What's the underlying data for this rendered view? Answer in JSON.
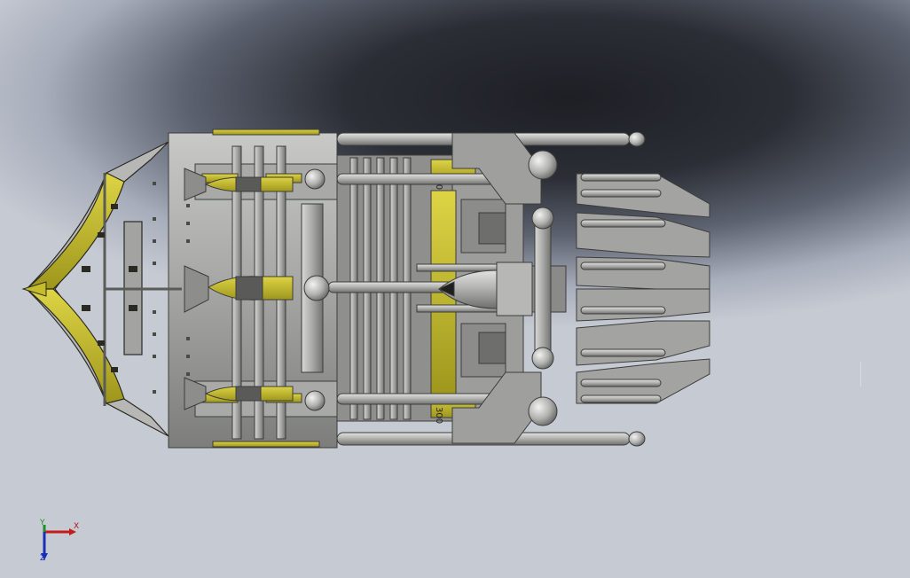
{
  "viewport": {
    "background_top": "#1d1f25",
    "background_bottom": "#c6cad3"
  },
  "model": {
    "body_color": "#9c9d9b",
    "accent_color": "#c5bc2c",
    "stripe_color": "#2a2a22",
    "decals": [
      {
        "text": "300"
      },
      {
        "text": "300"
      }
    ]
  },
  "triad": {
    "x_label": "X",
    "y_label": "Y",
    "z_label": "Z",
    "x_color": "#c41c1c",
    "y_color": "#1f8f2a",
    "z_color": "#1a2fb8"
  }
}
